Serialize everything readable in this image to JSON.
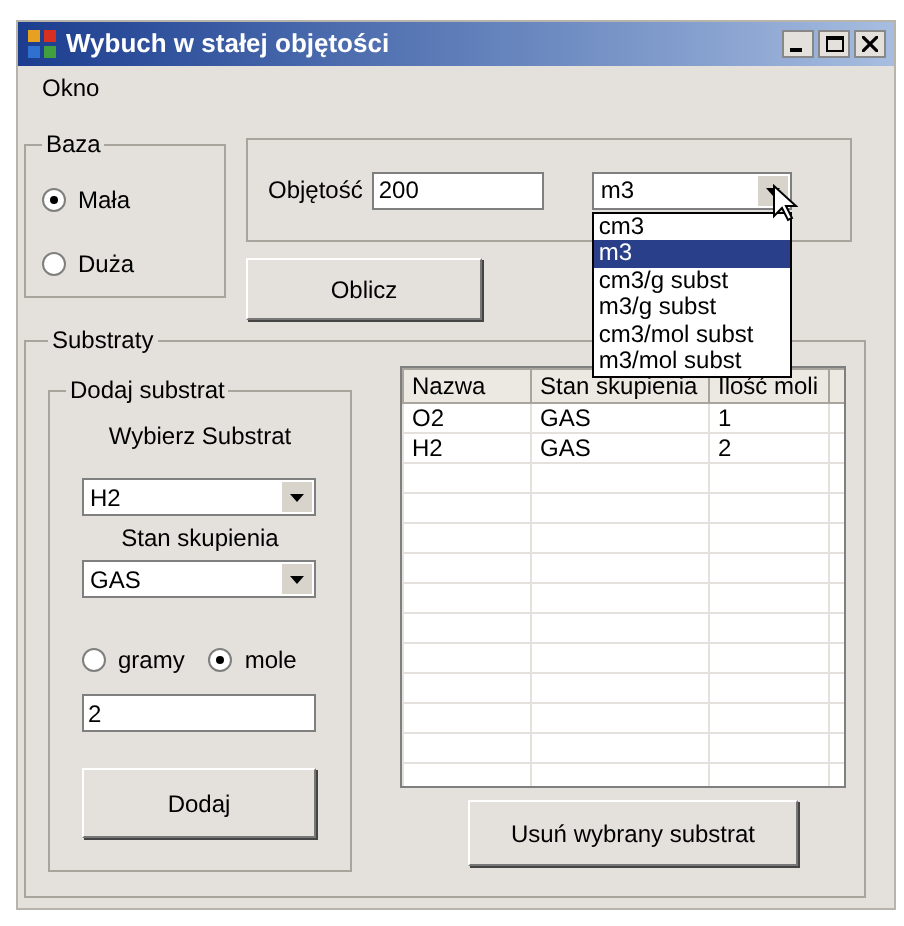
{
  "window": {
    "title": "Wybuch w stałej objętości"
  },
  "menu": [
    "Okno"
  ],
  "baza": {
    "title": "Baza",
    "options": [
      {
        "label": "Mała",
        "selected": true
      },
      {
        "label": "Duża",
        "selected": false
      }
    ]
  },
  "volume": {
    "label": "Objętość",
    "value": "200",
    "unit": {
      "value": "m3",
      "expanded": true,
      "options": [
        {
          "label": "cm3",
          "selected": false
        },
        {
          "label": "m3",
          "selected": true
        },
        {
          "label": "cm3/g subst",
          "selected": false
        },
        {
          "label": "m3/g subst",
          "selected": false
        },
        {
          "label": "cm3/mol subst",
          "selected": false
        },
        {
          "label": "m3/mol subst",
          "selected": false
        }
      ]
    }
  },
  "calculate_button": "Oblicz",
  "substraty": {
    "title": "Substraty",
    "add": {
      "title": "Dodaj substrat",
      "substrate_label": "Wybierz Substrat",
      "substrate": "H2",
      "state_label": "Stan skupienia",
      "state": "GAS",
      "units": [
        {
          "label": "gramy",
          "selected": false
        },
        {
          "label": "mole",
          "selected": true
        }
      ],
      "amount": "2",
      "add_button": "Dodaj"
    },
    "table": {
      "columns": [
        "Nazwa",
        "Stan skupienia",
        "Ilość moli"
      ],
      "rows": [
        [
          "O2",
          "GAS",
          "1"
        ],
        [
          "H2",
          "GAS",
          "2"
        ]
      ]
    },
    "remove_button": "Usuń wybrany substrat"
  }
}
